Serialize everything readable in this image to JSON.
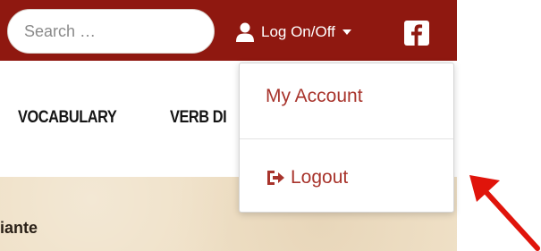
{
  "header": {
    "search": {
      "placeholder": "Search …",
      "value": ""
    },
    "login_label": "Log On/Off",
    "social_icon": "facebook-icon"
  },
  "nav": {
    "items": [
      {
        "label": "VOCABULARY"
      },
      {
        "label": "VERB DI"
      }
    ]
  },
  "content": {
    "text": "iante"
  },
  "dropdown": {
    "items": [
      {
        "label": "My Account"
      },
      {
        "label": "Logout",
        "icon": "logout-icon"
      }
    ]
  },
  "colors": {
    "header_bg": "#8f1810",
    "dropdown_text": "#a8342c",
    "content_bg": "#efe0c6",
    "annotation_arrow": "#e0140b"
  }
}
